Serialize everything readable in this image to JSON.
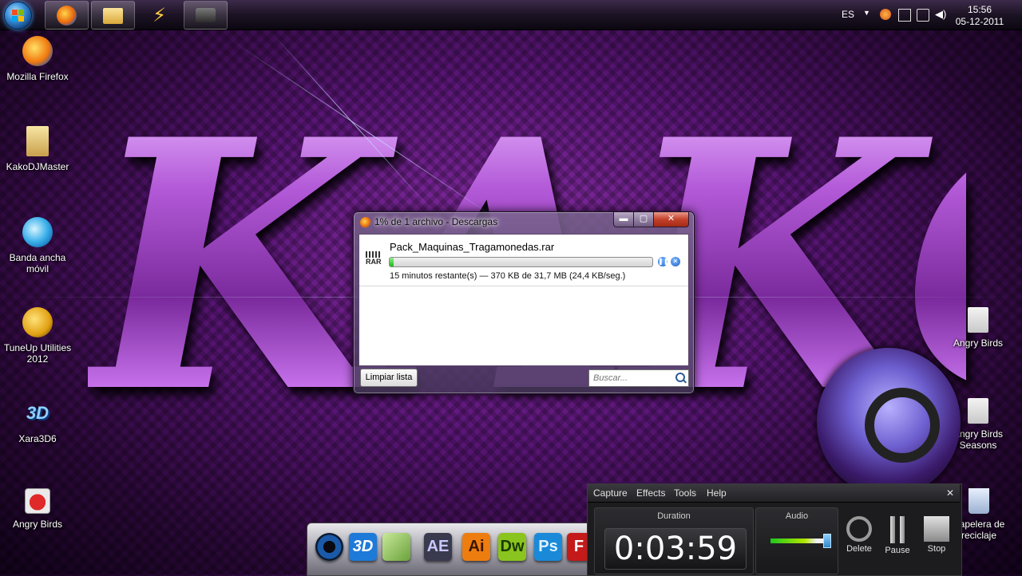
{
  "taskbar": {
    "apps": [
      {
        "name": "firefox"
      },
      {
        "name": "explorer"
      },
      {
        "name": "winamp"
      },
      {
        "name": "camcorder"
      }
    ],
    "language": "ES",
    "clock_time": "15:56",
    "clock_date": "05-12-2011"
  },
  "desktop": {
    "left_icons": [
      {
        "label": "Mozilla Firefox",
        "icon": "firefox-icon"
      },
      {
        "label": "KakoDJMaster",
        "icon": "folder-icon"
      },
      {
        "label": "Banda ancha móvil",
        "icon": "broadband-icon"
      },
      {
        "label": "TuneUp Utilities 2012",
        "icon": "tuneup-icon"
      },
      {
        "label": "Xara3D6",
        "icon": "xara3d-icon"
      },
      {
        "label": "Angry Birds",
        "icon": "angry-birds-icon"
      }
    ],
    "right_icons": [
      {
        "label": "Angry Birds",
        "icon": "angry-birds-shortcut-icon"
      },
      {
        "label": "Angry Birds Seasons",
        "icon": "angry-birds-seasons-icon"
      },
      {
        "label": "Papelera de reciclaje",
        "icon": "recycle-bin-icon"
      }
    ]
  },
  "downloads": {
    "title": "1% de 1 archivo - Descargas",
    "close_glyph": "✕",
    "item": {
      "filename": "Pack_Maquinas_Tragamonedas.rar",
      "icon_text": "RAR",
      "progress": 0.01,
      "status": "15 minutos restante(s) — 370 KB de 31,7 MB (24,4 KB/seg.)"
    },
    "clear_button": "Limpiar lista",
    "search_placeholder": "Buscar..."
  },
  "dock": {
    "apps": [
      {
        "label": "",
        "icon": "camera-lens-icon",
        "color": "#1a5aa8"
      },
      {
        "label": "3D",
        "icon": "xara3d-dock-icon",
        "color": "#1e7ad8"
      },
      {
        "label": "",
        "icon": "media-icon",
        "color": "#6aa23a"
      },
      {
        "label": "AE",
        "icon": "after-effects-icon",
        "color": "#3a3a4e"
      },
      {
        "label": "Ai",
        "icon": "illustrator-icon",
        "color": "#ee7d10"
      },
      {
        "label": "Dw",
        "icon": "dreamweaver-icon",
        "color": "#8ac41e"
      },
      {
        "label": "Ps",
        "icon": "photoshop-icon",
        "color": "#1a8ad8"
      },
      {
        "label": "F",
        "icon": "flash-icon",
        "color": "#c41a1a"
      }
    ]
  },
  "recorder": {
    "menu": [
      "Capture",
      "Effects",
      "Tools",
      "Help"
    ],
    "duration_label": "Duration",
    "duration_value": "0:03:59",
    "audio_label": "Audio",
    "buttons": [
      {
        "label": "Delete",
        "icon": "delete-icon"
      },
      {
        "label": "Pause",
        "icon": "pause-icon"
      },
      {
        "label": "Stop",
        "icon": "stop-icon"
      }
    ]
  }
}
